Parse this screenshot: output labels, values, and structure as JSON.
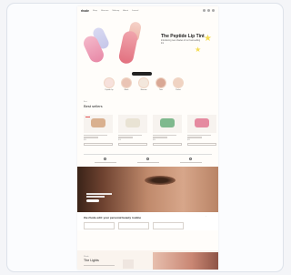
{
  "nav": {
    "logo": "rhode",
    "links": [
      "Shop",
      "Skincare",
      "Makeup",
      "About",
      "Journal"
    ]
  },
  "hero": {
    "title": "The Peptide Lip Tint",
    "subtitle": "Introducing new shades of our best-selling tint"
  },
  "categories": [
    {
      "label": "Peptide Lip"
    },
    {
      "label": "Blush"
    },
    {
      "label": "Skincare"
    },
    {
      "label": "Tints"
    },
    {
      "label": "Pocket"
    }
  ],
  "best_sellers": {
    "eyebrow": "Best",
    "title": "Best sellers",
    "products": [
      {
        "badge": "New",
        "price": "$24"
      },
      {
        "badge": "",
        "price": "$16"
      },
      {
        "badge": "",
        "price": "$24"
      },
      {
        "badge": "",
        "price": "$22"
      }
    ]
  },
  "strip": {
    "text": "the rhode edit: your personal beauty routine",
    "cta": "→"
  },
  "bottom": {
    "eyebrow": "Rhode",
    "title": "The Lights"
  },
  "colors": {
    "accent_pink": "#f0a5ad",
    "star_yellow": "#f4dc55",
    "page_bg": "#fffdfa"
  }
}
